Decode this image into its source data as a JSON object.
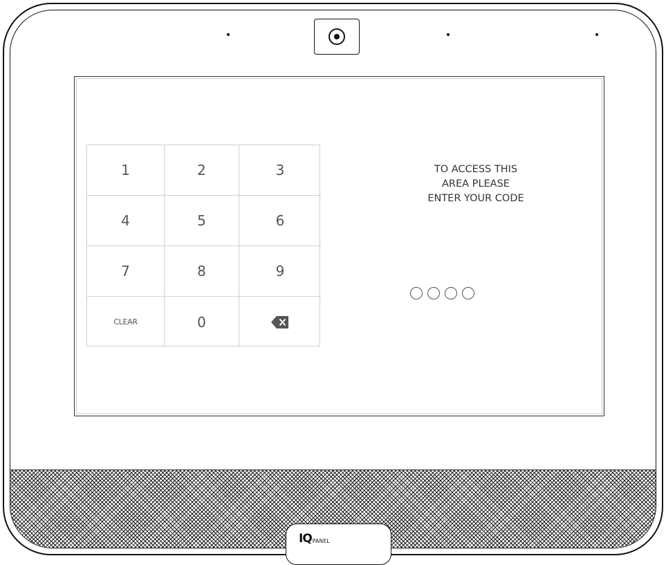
{
  "keypad": {
    "keys": [
      "1",
      "2",
      "3",
      "4",
      "5",
      "6",
      "7",
      "8",
      "9",
      "CLEAR",
      "0",
      "backspace-icon"
    ]
  },
  "prompt": {
    "line1": "TO ACCESS THIS",
    "line2": "AREA PLEASE",
    "line3": "ENTER YOUR CODE"
  },
  "pin": {
    "length": 4,
    "entered": 0
  },
  "brand": {
    "iq": "IQ",
    "panel": "PANEL"
  },
  "colors": {
    "frame": "#111111",
    "key_text": "#555555",
    "grid": "#cfcfcf",
    "backspace": "#555555"
  }
}
